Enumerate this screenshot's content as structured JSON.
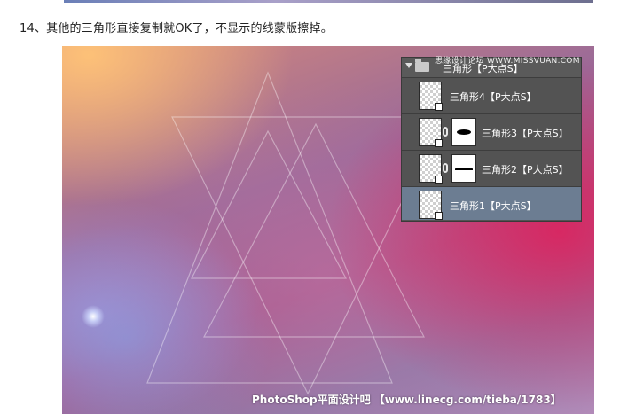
{
  "article": {
    "step_text": "14、其他的三角形直接复制就OK了，不显示的线蒙版擦掉。"
  },
  "layers_panel": {
    "watermark_site": "思缘设计论坛 WWW.MISSVUAN.COM",
    "group": {
      "name": "三角形【P大点S】",
      "icon": "folder-icon",
      "expanded": true
    },
    "layers": [
      {
        "name": "三角形4【P大点S】",
        "has_mask": false,
        "selected": false
      },
      {
        "name": "三角形3【P大点S】",
        "has_mask": true,
        "mask_shape": "blob",
        "selected": false
      },
      {
        "name": "三角形2【P大点S】",
        "has_mask": true,
        "mask_shape": "line",
        "selected": false
      },
      {
        "name": "三角形1【P大点S】",
        "has_mask": false,
        "selected": true
      }
    ]
  },
  "canvas": {
    "bottom_watermark": "PhotoShop平面设计吧 【www.linecg.com/tieba/1783】"
  },
  "colors": {
    "panel_bg": "#535353",
    "selected_row": "#6c7d92",
    "warm_corner": "#ffc478",
    "magenta": "#e11e5a"
  }
}
